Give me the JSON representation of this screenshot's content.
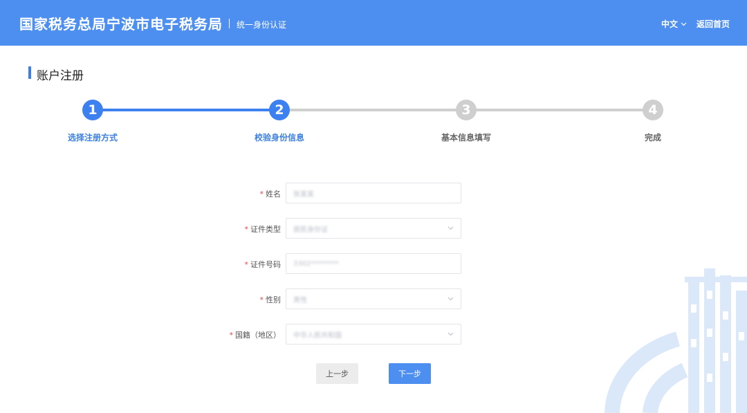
{
  "header": {
    "title": "国家税务总局宁波市电子税务局",
    "subtitle": "统一身份认证",
    "language": "中文",
    "home_link": "返回首页"
  },
  "page": {
    "title": "账户注册"
  },
  "steps": [
    {
      "number": "1",
      "label": "选择注册方式",
      "state": "active"
    },
    {
      "number": "2",
      "label": "校验身份信息",
      "state": "active"
    },
    {
      "number": "3",
      "label": "基本信息填写",
      "state": "inactive"
    },
    {
      "number": "4",
      "label": "完成",
      "state": "inactive"
    }
  ],
  "form": {
    "fields": [
      {
        "label": "姓名",
        "required": "*",
        "value": "张某某",
        "type": "text"
      },
      {
        "label": "证件类型",
        "required": "*",
        "value": "居民身份证",
        "type": "select"
      },
      {
        "label": "证件号码",
        "required": "*",
        "value": "3302********",
        "type": "text"
      },
      {
        "label": "性别",
        "required": "*",
        "value": "男性",
        "type": "select"
      },
      {
        "label": "国籍（地区）",
        "required": "*",
        "value": "中华人民共和国",
        "type": "select"
      }
    ]
  },
  "buttons": {
    "prev": "上一步",
    "next": "下一步"
  },
  "colors": {
    "primary": "#4d8ff0",
    "step_active": "#3d80ef",
    "step_inactive": "#cfcfcf",
    "required": "#e84a4a"
  },
  "icons": {
    "language_dropdown": "chevron-down-icon",
    "select_dropdown": "chevron-down-icon",
    "watermark": "tax-bureau-emblem"
  }
}
